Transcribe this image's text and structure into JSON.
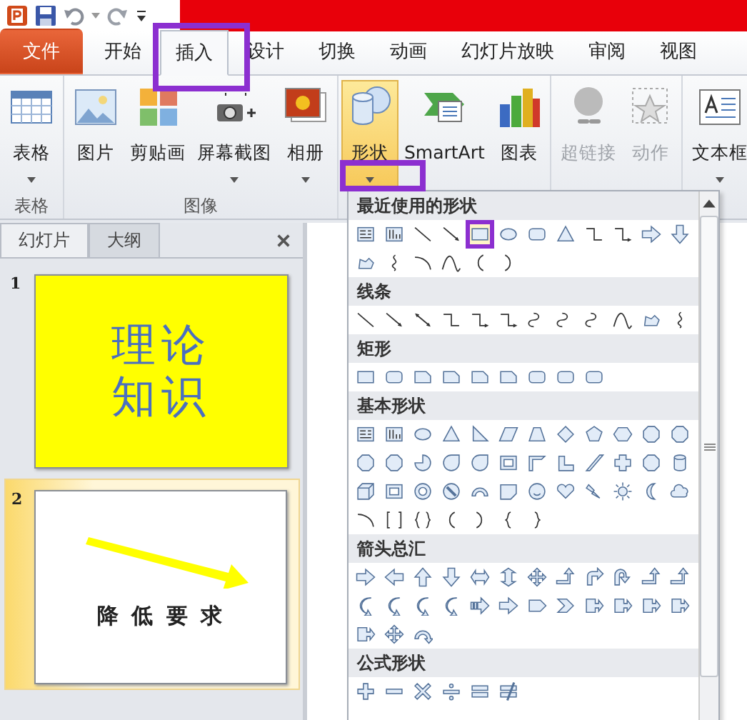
{
  "tabs": [
    {
      "label": "文件",
      "kind": "file",
      "selected": false
    },
    {
      "label": "开始",
      "kind": "tab",
      "selected": false
    },
    {
      "label": "插入",
      "kind": "tab",
      "selected": true
    },
    {
      "label": "设计",
      "kind": "tab",
      "selected": false
    },
    {
      "label": "切换",
      "kind": "tab",
      "selected": false
    },
    {
      "label": "动画",
      "kind": "tab",
      "selected": false
    },
    {
      "label": "幻灯片放映",
      "kind": "tab",
      "selected": false
    },
    {
      "label": "审阅",
      "kind": "tab",
      "selected": false
    },
    {
      "label": "视图",
      "kind": "tab",
      "selected": false
    }
  ],
  "ribbon": {
    "groups": [
      {
        "label": "表格",
        "buttons": [
          {
            "label": "表格",
            "dropdown": true,
            "disabled": false,
            "pressed": false
          }
        ]
      },
      {
        "label": "图像",
        "buttons": [
          {
            "label": "图片",
            "dropdown": false,
            "disabled": false,
            "pressed": false
          },
          {
            "label": "剪贴画",
            "dropdown": false,
            "disabled": false,
            "pressed": false
          },
          {
            "label": "屏幕截图",
            "dropdown": true,
            "disabled": false,
            "pressed": false
          },
          {
            "label": "相册",
            "dropdown": true,
            "disabled": false,
            "pressed": false
          }
        ]
      },
      {
        "buttons": [
          {
            "label": "形状",
            "dropdown": true,
            "disabled": false,
            "pressed": true
          },
          {
            "label": "SmartArt",
            "dropdown": false,
            "disabled": false,
            "pressed": false
          },
          {
            "label": "图表",
            "dropdown": false,
            "disabled": false,
            "pressed": false
          }
        ]
      },
      {
        "buttons": [
          {
            "label": "超链接",
            "dropdown": false,
            "disabled": true,
            "pressed": false
          },
          {
            "label": "动作",
            "dropdown": false,
            "disabled": true,
            "pressed": false
          }
        ]
      },
      {
        "buttons": [
          {
            "label": "文本框",
            "dropdown": true,
            "disabled": false,
            "pressed": false
          }
        ]
      }
    ]
  },
  "slides_panel": {
    "tabs": [
      {
        "label": "幻灯片",
        "selected": true
      },
      {
        "label": "大纲",
        "selected": false
      }
    ],
    "slides": [
      {
        "number": "1",
        "kind": "title",
        "selected": false,
        "lines": [
          "理论",
          "知识"
        ]
      },
      {
        "number": "2",
        "kind": "arrow",
        "selected": true,
        "lines": [
          "降 低 要 求"
        ]
      }
    ]
  },
  "shapes_gallery": {
    "sections": [
      {
        "title": "最近使用的形状"
      },
      {
        "title": "线条"
      },
      {
        "title": "矩形"
      },
      {
        "title": "基本形状"
      },
      {
        "title": "箭头总汇"
      },
      {
        "title": "公式形状"
      }
    ]
  }
}
